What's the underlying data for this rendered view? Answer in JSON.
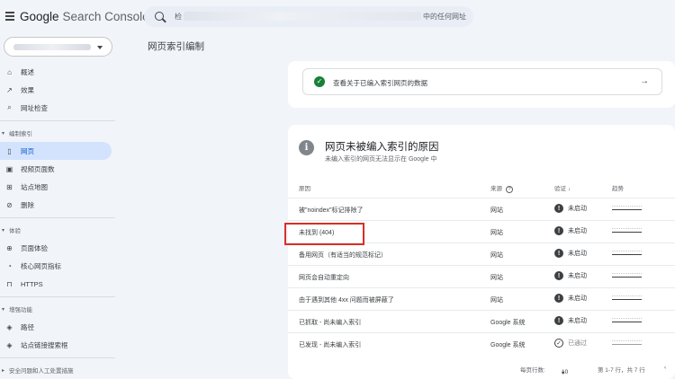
{
  "app": {
    "brand_google": "Google",
    "brand_product": "Search Console"
  },
  "search": {
    "placeholder_prefix": "检",
    "placeholder_suffix": "中的任何网址"
  },
  "page_title": "网页索引编制",
  "sidebar": {
    "top_items": [
      {
        "label": "概述",
        "icon": "home-icon"
      },
      {
        "label": "效果",
        "icon": "trending-icon"
      },
      {
        "label": "网址检查",
        "icon": "search-icon"
      }
    ],
    "sections": [
      {
        "title": "编制索引",
        "items": [
          {
            "label": "网页",
            "icon": "pages-icon",
            "active": true
          },
          {
            "label": "视频页面数",
            "icon": "video-icon"
          },
          {
            "label": "站点地图",
            "icon": "sitemap-icon"
          },
          {
            "label": "删除",
            "icon": "removal-icon"
          }
        ]
      },
      {
        "title": "体验",
        "items": [
          {
            "label": "页面体验",
            "icon": "experience-icon"
          },
          {
            "label": "核心网页指标",
            "icon": "speed-icon"
          },
          {
            "label": "HTTPS",
            "icon": "lock-icon"
          }
        ]
      },
      {
        "title": "增强功能",
        "items": [
          {
            "label": "路径",
            "icon": "layers-icon"
          },
          {
            "label": "站点链接搜索框",
            "icon": "layers-icon"
          }
        ]
      }
    ],
    "bottom_section": "安全问题和人工处置措施"
  },
  "indexed_card": {
    "text": "查看关于已编入索引网页的数据",
    "arrow": "→"
  },
  "reasons_card": {
    "title": "网页未被编入索引的原因",
    "subtitle": "未编入索引的网页无法显示在 Google 中",
    "columns": {
      "reason": "原因",
      "source": "来源",
      "validation": "验证",
      "trend": "趋势"
    },
    "rows": [
      {
        "reason": "被\"noindex\"标记排除了",
        "source": "网站",
        "validation": "未启动",
        "status": "warn"
      },
      {
        "reason": "未找到 (404)",
        "source": "网站",
        "validation": "未启动",
        "status": "warn"
      },
      {
        "reason": "备用网页（有适当的规范标记）",
        "source": "网站",
        "validation": "未启动",
        "status": "warn"
      },
      {
        "reason": "网页会自动重定向",
        "source": "网站",
        "validation": "未启动",
        "status": "warn"
      },
      {
        "reason": "由于遇到其他 4xx 问题而被屏蔽了",
        "source": "网站",
        "validation": "未启动",
        "status": "warn"
      },
      {
        "reason": "已抓取 - 尚未编入索引",
        "source": "Google 系统",
        "validation": "未启动",
        "status": "warn"
      },
      {
        "reason": "已发现 - 尚未编入索引",
        "source": "Google 系统",
        "validation": "已通过",
        "status": "pass"
      }
    ],
    "pager": {
      "rows_label": "每页行数:",
      "rows_value": "10",
      "range": "第 1-7 行，共 7 行"
    }
  },
  "colors": {
    "accent": "#0b57d0",
    "active_bg": "#d3e3fd",
    "highlight": "#d93025",
    "success": "#188038"
  }
}
